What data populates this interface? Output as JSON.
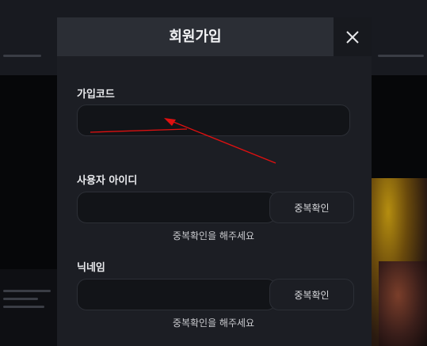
{
  "modal": {
    "title": "회원가입",
    "close_icon": "close-icon"
  },
  "fields": {
    "signup_code": {
      "label": "가입코드",
      "value": "",
      "placeholder": ""
    },
    "user_id": {
      "label": "사용자 아이디",
      "value": "",
      "placeholder": "",
      "check_button": "중복확인",
      "hint": "중복확인을 해주세요"
    },
    "nickname": {
      "label": "닉네임",
      "value": "",
      "placeholder": "",
      "check_button": "중복확인",
      "hint": "중복확인을 해주세요"
    }
  },
  "colors": {
    "modal_bg": "#1c1e24",
    "header_bg": "#2b2e35",
    "input_bg": "#121418",
    "annotation_arrow": "#e01010"
  }
}
